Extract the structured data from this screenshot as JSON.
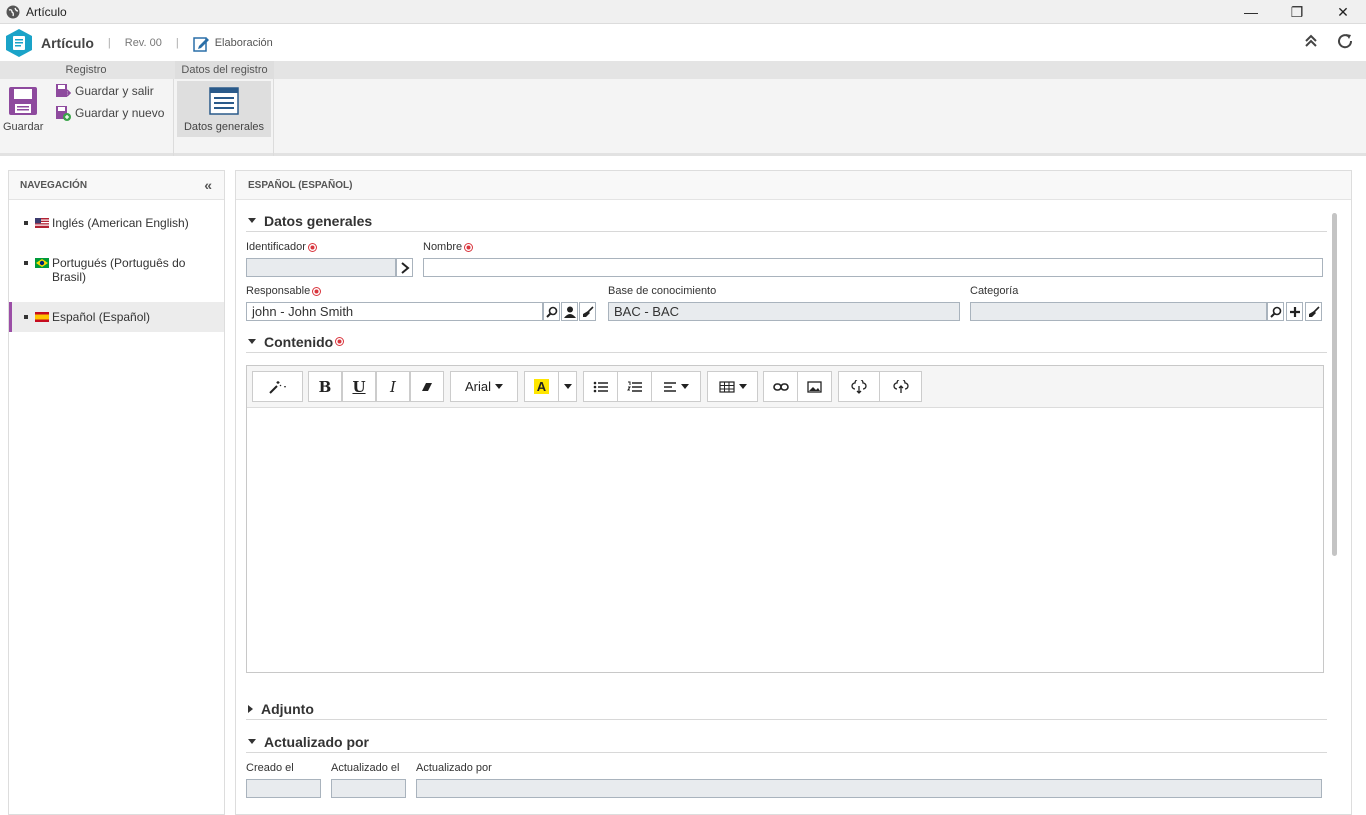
{
  "window": {
    "title": "Artículo",
    "minimize": "—",
    "restore": "❐",
    "close": "✕"
  },
  "header": {
    "app_name": "Artículo",
    "revision": "Rev. 00",
    "separator": "|",
    "status": "Elaboración"
  },
  "ribbon": {
    "tabs": [
      "Registro",
      "Datos del registro"
    ],
    "save": "Guardar",
    "save_exit": "Guardar y salir",
    "save_new": "Guardar y nuevo",
    "general_data": "Datos generales"
  },
  "nav": {
    "title": "NAVEGACIÓN",
    "collapse": "«",
    "items": [
      {
        "label": "Inglés (American English)"
      },
      {
        "label": "Portugués (Português do Brasil)"
      },
      {
        "label": "Español (Español)"
      }
    ]
  },
  "main": {
    "title": "ESPAÑOL (ESPAÑOL)",
    "sections": {
      "general": "Datos generales",
      "content": "Contenido",
      "attachment": "Adjunto",
      "updated": "Actualizado por"
    },
    "labels": {
      "identifier": "Identificador",
      "name": "Nombre",
      "responsible": "Responsable",
      "knowledge_base": "Base de conocimiento",
      "category": "Categoría",
      "created_on": "Creado el",
      "updated_on": "Actualizado el",
      "updated_by": "Actualizado por"
    },
    "values": {
      "identifier": "",
      "name": "",
      "responsible": "john - John Smith",
      "knowledge_base": "BAC - BAC",
      "category": "",
      "created_on": "",
      "updated_on": "",
      "updated_by": ""
    },
    "editor": {
      "font": "Arial",
      "bold": "B",
      "underline": "U",
      "italic": "I",
      "highlight": "A"
    }
  },
  "colors": {
    "accent": "#9b4ea6",
    "logo": "#1aa3c8",
    "required": "#d9363e"
  }
}
